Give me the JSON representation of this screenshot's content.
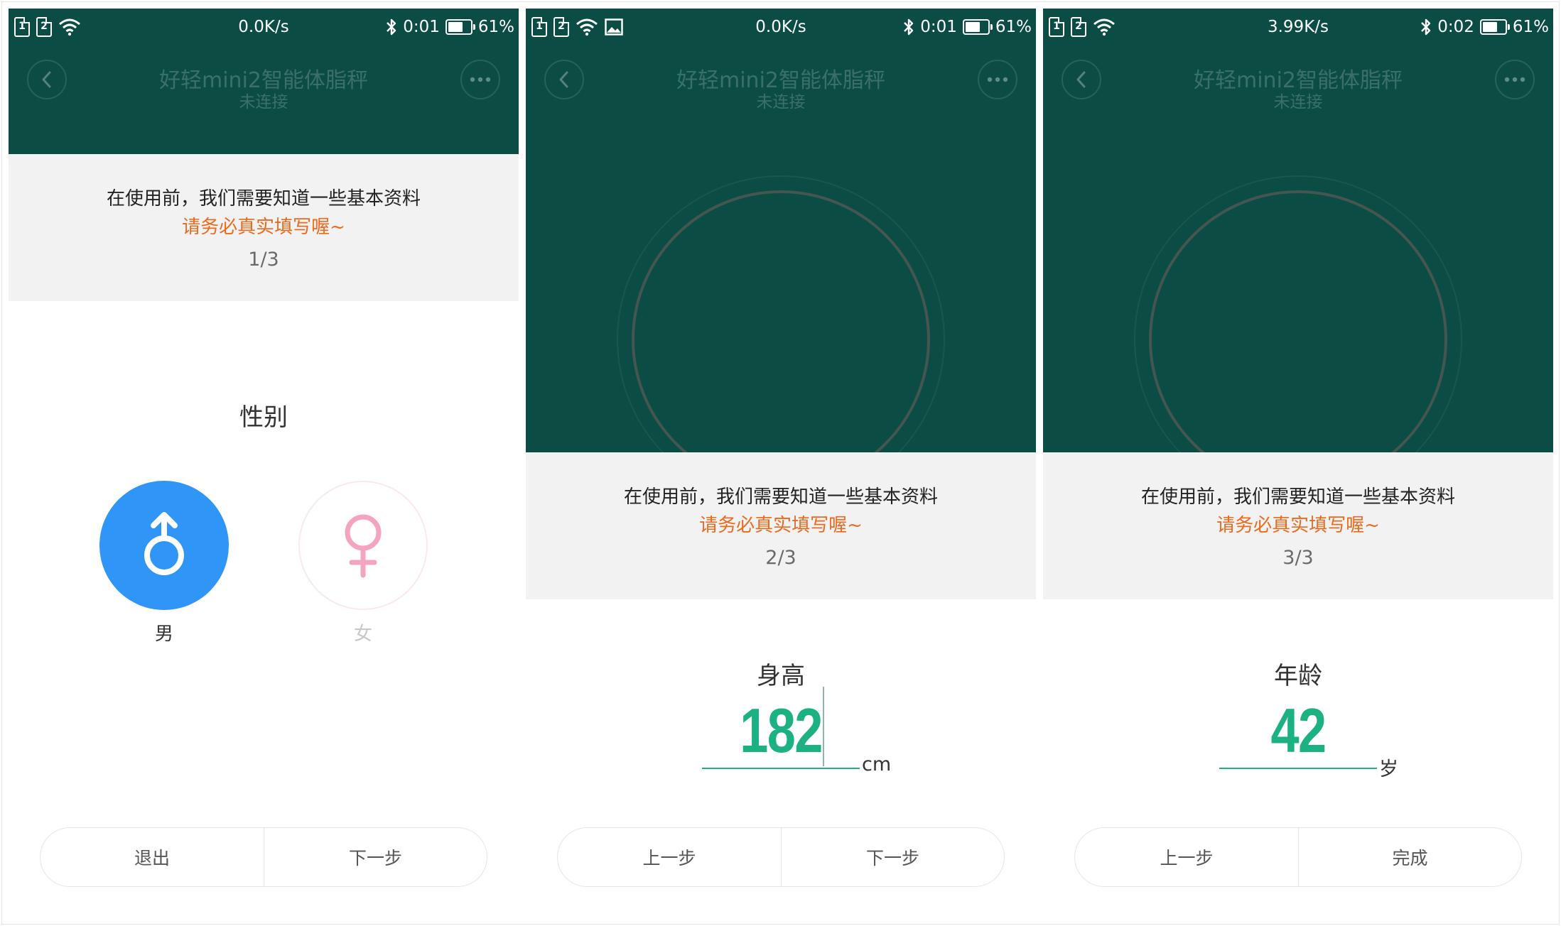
{
  "theme": {
    "header_bg": "#0b4c45",
    "accent_green": "#1bb183",
    "warning_orange": "#ea6b1f",
    "male_blue": "#2f96f8",
    "female_pink": "#f4a3c0"
  },
  "screens": [
    {
      "status": {
        "sim1": "1",
        "sim2": "2",
        "speed": "0.0K/s",
        "time": "0:01",
        "battery": "61%",
        "icons": [
          "sim-icon",
          "sim-icon",
          "wifi-icon",
          "bluetooth-icon",
          "battery-icon"
        ]
      },
      "nav": {
        "title": "好轻mini2智能体脂秤",
        "subtitle": "未连接",
        "back_icon": "chevron-left-icon",
        "more_icon": "more-dots-icon"
      },
      "info": {
        "main": "在使用前，我们需要知道一些基本资料",
        "warn": "请务必真实填写喔~",
        "step": "1/3"
      },
      "gender": {
        "label": "性别",
        "male": "男",
        "female": "女",
        "selected": "男"
      },
      "buttons": {
        "left": "退出",
        "right": "下一步"
      }
    },
    {
      "status": {
        "sim1": "1",
        "sim2": "2",
        "speed": "0.0K/s",
        "time": "0:01",
        "battery": "61%",
        "icons": [
          "sim-icon",
          "sim-icon",
          "wifi-icon",
          "image-icon",
          "bluetooth-icon",
          "battery-icon"
        ]
      },
      "nav": {
        "title": "好轻mini2智能体脂秤",
        "subtitle": "未连接"
      },
      "info": {
        "main": "在使用前，我们需要知道一些基本资料",
        "warn": "请务必真实填写喔~",
        "step": "2/3"
      },
      "field": {
        "label": "身高",
        "value": "182",
        "unit": "cm"
      },
      "buttons": {
        "left": "上一步",
        "right": "下一步"
      }
    },
    {
      "status": {
        "sim1": "1",
        "sim2": "2",
        "speed": "3.99K/s",
        "time": "0:02",
        "battery": "61%",
        "icons": [
          "sim-icon",
          "sim-icon",
          "wifi-icon",
          "bluetooth-icon",
          "battery-icon"
        ]
      },
      "nav": {
        "title": "好轻mini2智能体脂秤",
        "subtitle": "未连接"
      },
      "info": {
        "main": "在使用前，我们需要知道一些基本资料",
        "warn": "请务必真实填写喔~",
        "step": "3/3"
      },
      "field": {
        "label": "年龄",
        "value": "42",
        "unit": "岁"
      },
      "buttons": {
        "left": "上一步",
        "right": "完成"
      }
    }
  ]
}
